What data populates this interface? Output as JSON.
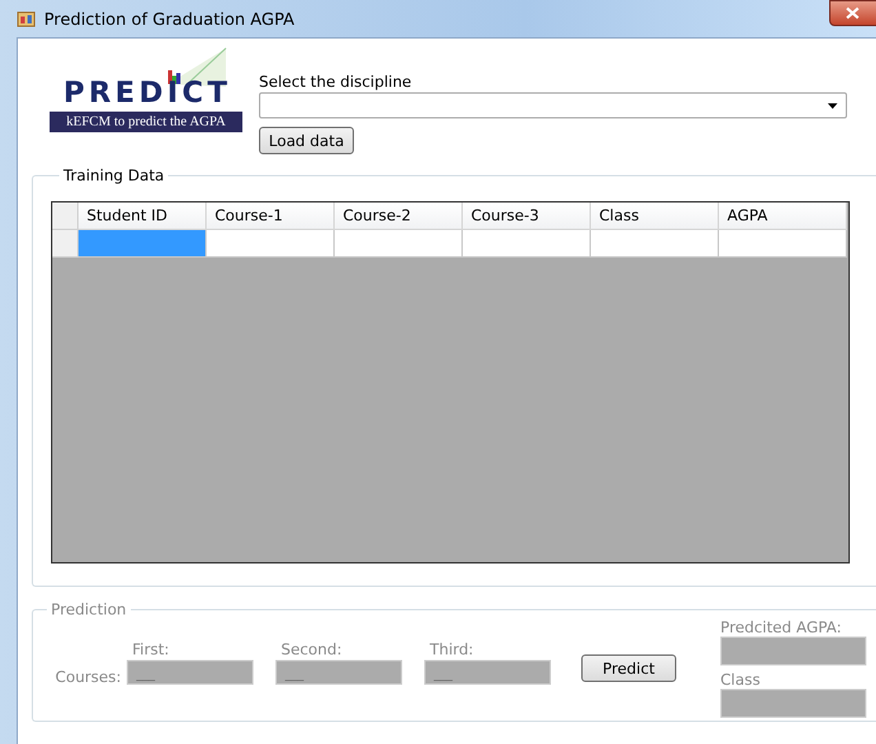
{
  "window": {
    "title": "Prediction of Graduation AGPA"
  },
  "logo": {
    "name": "PREDICT",
    "tagline": "kEFCM to predict the AGPA"
  },
  "discipline": {
    "label": "Select the discipline"
  },
  "load_button": "Load data",
  "training": {
    "title": "Training Data",
    "columns": [
      "Student ID",
      "Course-1",
      "Course-2",
      "Course-3",
      "Class",
      "AGPA"
    ],
    "rows": [
      {
        "cells": [
          {
            "selected": true
          },
          {
            "selected": false
          },
          {
            "selected": false
          },
          {
            "selected": false
          },
          {
            "selected": false
          },
          {
            "selected": false
          }
        ]
      }
    ]
  },
  "prediction": {
    "title": "Prediction",
    "disabled": true,
    "courses_label": "Courses:",
    "courses": [
      {
        "label": "First:",
        "value": "___"
      },
      {
        "label": "Second:",
        "value": "___"
      },
      {
        "label": "Third:",
        "value": "___"
      }
    ],
    "predict_button": "Predict",
    "agpa_label": "Predcited AGPA:",
    "class_label": "Class"
  }
}
